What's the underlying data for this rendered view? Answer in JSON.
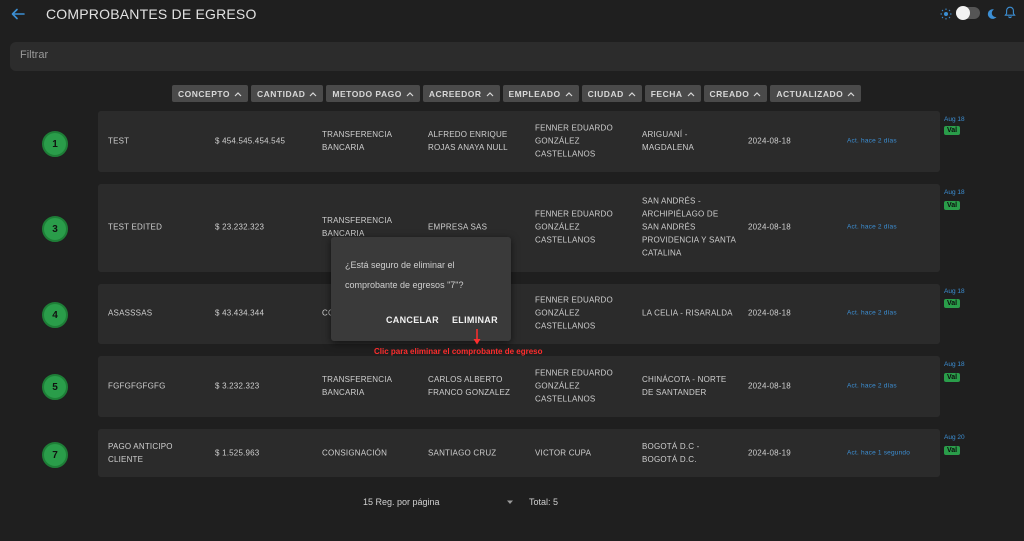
{
  "header": {
    "title": "COMPROBANTES DE EGRESO",
    "back_icon": "arrow-left-icon",
    "theme_icons": [
      "sun-icon",
      "moon-icon"
    ],
    "notification_icon": "bell-icon",
    "accent": "#3c8fd4"
  },
  "filter": {
    "placeholder": "Filtrar"
  },
  "sort_buttons": [
    {
      "label": "CONCEPTO"
    },
    {
      "label": "CANTIDAD"
    },
    {
      "label": "METODO PAGO"
    },
    {
      "label": "ACREEDOR"
    },
    {
      "label": "EMPLEADO"
    },
    {
      "label": "CIUDAD"
    },
    {
      "label": "FECHA"
    },
    {
      "label": "CREADO"
    },
    {
      "label": "ACTUALIZADO"
    }
  ],
  "rows": [
    {
      "id": "1",
      "concepto": "TEST",
      "cantidad": "$ 454.545.454.545",
      "metodo": "TRANSFERENCIA BANCARIA",
      "acreedor": "ALFREDO ENRIQUE ROJAS ANAYA NULL",
      "empleado": "FENNER EDUARDO GONZÁLEZ CASTELLANOS",
      "ciudad": "ARIGUANÍ - MAGDALENA",
      "fecha": "2024-08-18",
      "actualizado": "Act. hace 2 días",
      "side_date": "Aug 18",
      "badge": "Val"
    },
    {
      "id": "3",
      "concepto": "TEST EDITED",
      "cantidad": "$ 23.232.323",
      "metodo": "TRANSFERENCIA BANCARIA",
      "acreedor": "EMPRESA SAS",
      "empleado": "FENNER EDUARDO GONZÁLEZ CASTELLANOS",
      "ciudad": "SAN ANDRÉS - ARCHIPIÉLAGO DE SAN ANDRÉS PROVIDENCIA Y SANTA CATALINA",
      "fecha": "2024-08-18",
      "actualizado": "Act. hace 2 días",
      "side_date": "Aug 18",
      "badge": "Val"
    },
    {
      "id": "4",
      "concepto": "ASASSSAS",
      "cantidad": "$ 43.434.344",
      "metodo": "CO",
      "acreedor": "",
      "empleado": "FENNER EDUARDO GONZÁLEZ CASTELLANOS",
      "ciudad": "LA CELIA - RISARALDA",
      "fecha": "2024-08-18",
      "actualizado": "Act. hace 2 días",
      "side_date": "Aug 18",
      "badge": "Val"
    },
    {
      "id": "5",
      "concepto": "FGFGFGFGFG",
      "cantidad": "$ 3.232.323",
      "metodo": "TRANSFERENCIA BANCARIA",
      "acreedor": "CARLOS ALBERTO FRANCO GONZALEZ",
      "empleado": "FENNER EDUARDO GONZÁLEZ CASTELLANOS",
      "ciudad": "CHINÁCOTA - NORTE DE SANTANDER",
      "fecha": "2024-08-18",
      "actualizado": "Act. hace 2 días",
      "side_date": "Aug 18",
      "badge": "Val"
    },
    {
      "id": "7",
      "concepto": "PAGO ANTICIPO CLIENTE",
      "cantidad": "$ 1.525.963",
      "metodo": "CONSIGNACIÓN",
      "acreedor": "SANTIAGO CRUZ",
      "empleado": "VICTOR CUPA",
      "ciudad": "BOGOTÁ D.C - BOGOTÁ D.C.",
      "fecha": "2024-08-19",
      "actualizado": "Act. hace 1 segundo",
      "side_date": "Aug 20",
      "badge": "Val"
    }
  ],
  "dialog": {
    "message": "¿Está seguro de eliminar el comprobante de egresos \"7\"?",
    "cancel_label": "CANCELAR",
    "delete_label": "ELIMINAR"
  },
  "annotation": {
    "text": "Clic para eliminar el comprobante de egreso",
    "color": "#ff2d2d"
  },
  "footer": {
    "per_page": "15 Reg. por página",
    "total": "Total: 5"
  },
  "status_color": "#2a9d4a"
}
